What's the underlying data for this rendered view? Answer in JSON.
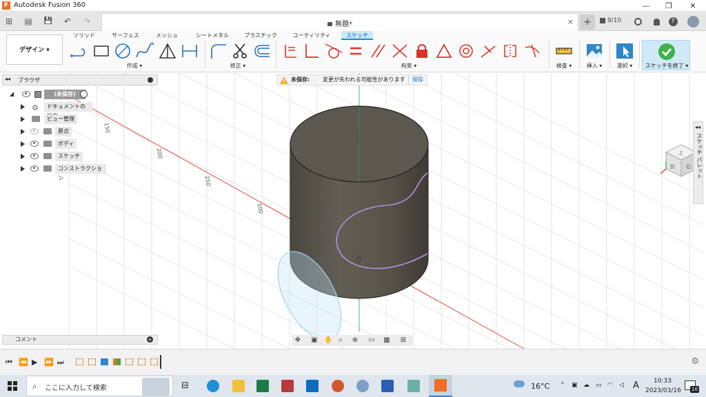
{
  "titlebar": {
    "app_logo": "F",
    "title": "Autodesk Fusion 360",
    "minimize": "—",
    "maximize": "❐",
    "close": "✕"
  },
  "qabar": {
    "grid_icon": "⊞",
    "file_icon": "▤",
    "save_icon": "💾",
    "undo": "↶",
    "redo": "↷",
    "doc_title": "無題*",
    "doc_close": "×",
    "new_tab": "+",
    "job_count": "9/10"
  },
  "ribbon": {
    "tabs": [
      "ソリッド",
      "サーフェス",
      "メッシュ",
      "シートメタル",
      "プラスチック",
      "ユーティリティ",
      "スケッチ"
    ],
    "design_button": "デザイン ▾",
    "groups": {
      "create": "作成 ▾",
      "modify": "修正 ▾",
      "constraints": "拘束 ▾",
      "inspect": "検査 ▾",
      "insert": "挿入 ▾",
      "select": "選択 ▾",
      "finish": "スケッチを終了 ▾"
    }
  },
  "browser": {
    "header": "ブラウザ",
    "root": "(未保存)",
    "items": [
      "ドキュメントの設定",
      "ビュー管理",
      "原点",
      "ボディ",
      "スケッチ",
      "コンストラクション"
    ]
  },
  "warning": {
    "label": "未保存:",
    "message": "変更が失われる可能性があります",
    "save": "保存"
  },
  "comments": {
    "label": "コメント",
    "add": "+"
  },
  "viewcube": {
    "top": "上",
    "front": "前",
    "right": "右"
  },
  "sketch_palette": "スケッチ パレット",
  "dimensions": [
    "100",
    "150",
    "100",
    "100",
    "200",
    "250"
  ],
  "taskbar": {
    "search_placeholder": "ここに入力して検索",
    "weather": "16°C",
    "ime": "A",
    "time": "10:33",
    "date": "2023/03/16",
    "notifications": "10"
  },
  "colors": {
    "accent": "#0696d7",
    "body_gray": "#58554b",
    "axis_red": "#e04a3a",
    "axis_green": "#39c45c",
    "sketch_purple": "#b58ee0"
  }
}
